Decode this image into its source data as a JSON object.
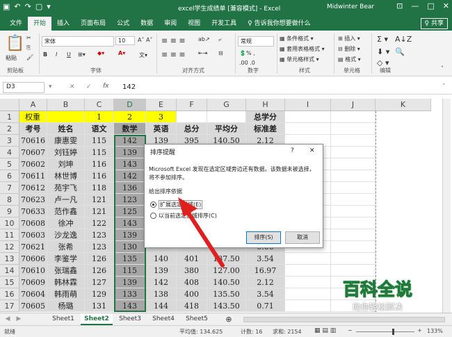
{
  "titlebar": {
    "save_icon": "save-icon",
    "title": "excel学生成绩单 [兼容模式] - Excel",
    "user": "Midwinter Bear",
    "minimize": "—",
    "restore": "□",
    "close": "✕"
  },
  "tabs": [
    "文件",
    "开始",
    "插入",
    "页面布局",
    "公式",
    "数据",
    "审阅",
    "视图",
    "开发工具",
    "♀ 告诉我你想要做什么"
  ],
  "share_label": "♀ 共享",
  "ribbon": {
    "paste_label": "粘贴",
    "clipboard_label": "剪贴板",
    "font_name": "宋体",
    "font_size": "10",
    "font_label": "字体",
    "align_label": "对齐方式",
    "number_format": "常规",
    "number_label": "数字",
    "cond_format": "条件格式",
    "table_format": "套用表格格式",
    "cell_style": "单元格样式",
    "style_label": "样式",
    "insert": "插入",
    "delete": "删除",
    "format": "格式",
    "cells_label": "单元格",
    "edit_label": "编辑",
    "bold": "B",
    "italic": "I",
    "underline": "U"
  },
  "formula": {
    "namebox": "D3",
    "fx": "fx",
    "value": "142"
  },
  "columns": [
    "A",
    "B",
    "C",
    "D",
    "E",
    "F",
    "G",
    "H",
    "I",
    "J",
    "K"
  ],
  "row_numbers": [
    "1",
    "2",
    "3",
    "4",
    "5",
    "6",
    "7",
    "8",
    "9",
    "10",
    "11",
    "12",
    "13",
    "14",
    "15",
    "16",
    "17"
  ],
  "rows": [
    [
      "权重",
      "",
      "1",
      "2",
      "3",
      "",
      "",
      "总学分"
    ],
    [
      "考号",
      "姓名",
      "语文",
      "数学",
      "英语",
      "总分",
      "平均分",
      "标准差"
    ],
    [
      "70616",
      "康惠雯",
      "115",
      "142",
      "139",
      "395",
      "140.50",
      "2.12"
    ],
    [
      "70607",
      "刘钰婷",
      "115",
      "139",
      "",
      "",
      "",
      "2.12"
    ],
    [
      "70602",
      "刘坤",
      "116",
      "143",
      "",
      "",
      "",
      "0.71"
    ],
    [
      "70611",
      "林世博",
      "116",
      "142",
      "",
      "",
      "",
      "1.41"
    ],
    [
      "70612",
      "苑宇飞",
      "118",
      "136",
      "",
      "",
      "",
      "0.00"
    ],
    [
      "70623",
      "卢一凡",
      "121",
      "123",
      "",
      "",
      "",
      "1.41"
    ],
    [
      "70633",
      "范作鑫",
      "121",
      "125",
      "",
      "",
      "",
      "1.41"
    ],
    [
      "70608",
      "徐冲",
      "122",
      "143",
      "",
      "",
      "",
      "4.24"
    ],
    [
      "70603",
      "沙龙逸",
      "123",
      "139",
      "",
      "",
      "",
      "1.41"
    ],
    [
      "70621",
      "张希",
      "123",
      "130",
      "",
      "",
      "",
      "0.00"
    ],
    [
      "70606",
      "李鉴学",
      "126",
      "135",
      "140",
      "401",
      "137.50",
      "3.54"
    ],
    [
      "70610",
      "张瑞鑫",
      "126",
      "115",
      "139",
      "380",
      "127.00",
      "16.97"
    ],
    [
      "70609",
      "韩林霖",
      "127",
      "139",
      "142",
      "408",
      "140.50",
      "2.12"
    ],
    [
      "70604",
      "韩雨萌",
      "129",
      "133",
      "138",
      "400",
      "135.50",
      "3.54"
    ],
    [
      "70605",
      "杨璐",
      "131",
      "143",
      "144",
      "418",
      "143.50",
      "0.71"
    ]
  ],
  "dialog": {
    "title": "排序提醒",
    "help": "?",
    "close": "✕",
    "message": "Microsoft Excel 发现在选定区域旁边还有数据。该数据未被选择，将不参加排序。",
    "group_label": "给出排序依据",
    "option1": "扩展选定区域(E)",
    "option2": "以当前选定区域排序(C)",
    "sort_button": "排序(S)",
    "cancel_button": "取消"
  },
  "sheets": [
    "Sheet1",
    "Sheet2",
    "Sheet3",
    "Sheet4",
    "Sheet5"
  ],
  "active_sheet": "Sheet2",
  "status": {
    "ready": "就绪",
    "average": "平均值: 134.625",
    "count": "计数: 16",
    "sum": "求和: 2154",
    "zoom": "133%"
  },
  "watermark": {
    "title": "百科全说",
    "subtitle": "助你轻松解决"
  },
  "colors": {
    "excel_green": "#217346",
    "highlight_yellow": "#ffff00",
    "selection_gray": "#a6a6a6",
    "arrow_red": "#e02020"
  }
}
